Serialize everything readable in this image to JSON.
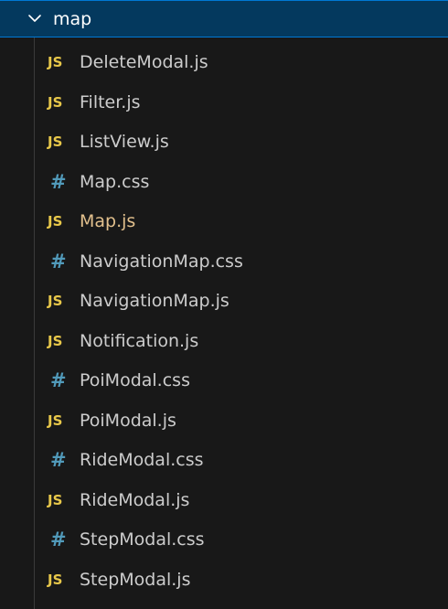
{
  "folder": {
    "name": "map",
    "expanded": true
  },
  "colors": {
    "js_icon": "#e8c84a",
    "css_icon": "#519aba",
    "modified_text": "#e2c08d",
    "selection_bg": "#04395e",
    "selection_border": "#0078d4"
  },
  "files": [
    {
      "icon": "JS",
      "type": "js",
      "name": "DeleteModal.js",
      "modified": false
    },
    {
      "icon": "JS",
      "type": "js",
      "name": "Filter.js",
      "modified": false
    },
    {
      "icon": "JS",
      "type": "js",
      "name": "ListView.js",
      "modified": false
    },
    {
      "icon": "#",
      "type": "css",
      "name": "Map.css",
      "modified": false
    },
    {
      "icon": "JS",
      "type": "js",
      "name": "Map.js",
      "modified": true
    },
    {
      "icon": "#",
      "type": "css",
      "name": "NavigationMap.css",
      "modified": false
    },
    {
      "icon": "JS",
      "type": "js",
      "name": "NavigationMap.js",
      "modified": false
    },
    {
      "icon": "JS",
      "type": "js",
      "name": "Notification.js",
      "modified": false
    },
    {
      "icon": "#",
      "type": "css",
      "name": "PoiModal.css",
      "modified": false
    },
    {
      "icon": "JS",
      "type": "js",
      "name": "PoiModal.js",
      "modified": false
    },
    {
      "icon": "#",
      "type": "css",
      "name": "RideModal.css",
      "modified": false
    },
    {
      "icon": "JS",
      "type": "js",
      "name": "RideModal.js",
      "modified": false
    },
    {
      "icon": "#",
      "type": "css",
      "name": "StepModal.css",
      "modified": false
    },
    {
      "icon": "JS",
      "type": "js",
      "name": "StepModal.js",
      "modified": false
    }
  ]
}
